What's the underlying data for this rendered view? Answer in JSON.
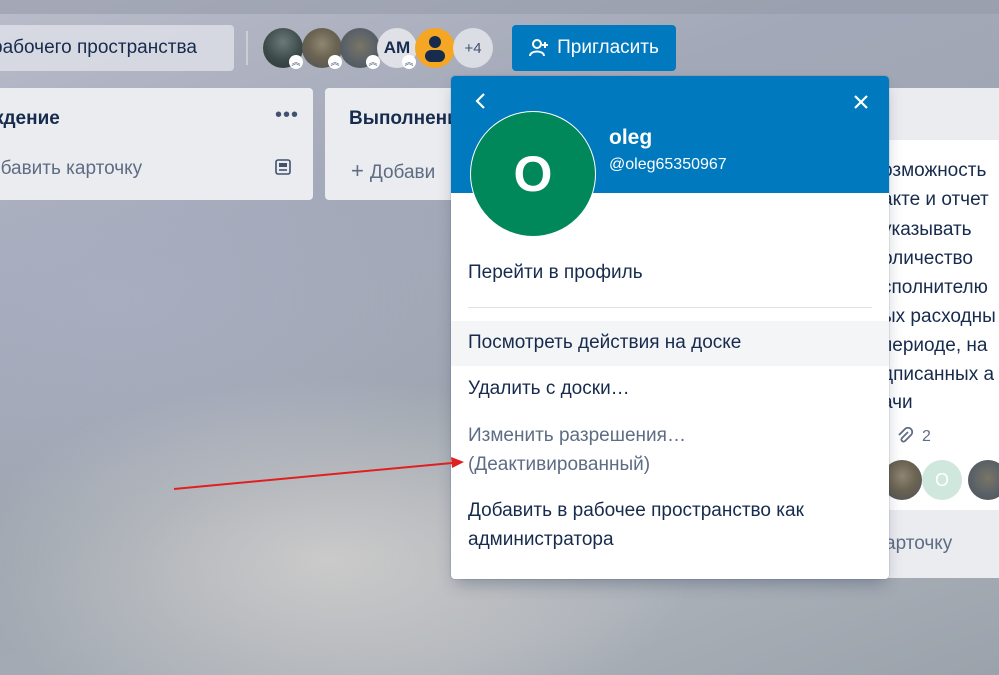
{
  "header": {
    "workspace_button": "рабочего пространства",
    "members_more": "+4",
    "member_am_initials": "AM",
    "invite_label": "Пригласить"
  },
  "lists": [
    {
      "title": "ждение",
      "add_card": "обавить карточку"
    },
    {
      "title": "Выполнени",
      "add_card": "Добави"
    }
  ],
  "right_card": {
    "lines": [
      "озможность",
      "акте и отчет",
      "указывать",
      "оличество",
      "сполнителю",
      "ых расходны",
      "периоде, на",
      "дписанных а",
      "ачи"
    ],
    "attachments_count": "2",
    "member_initial": "O",
    "add_card": "арточку"
  },
  "popover": {
    "avatar_initial": "O",
    "name": "oleg",
    "username": "@oleg65350967",
    "go_to_profile": "Перейти в профиль",
    "view_activity": "Посмотреть действия на доске",
    "remove_from_board": "Удалить с доски…",
    "change_permissions": "Изменить разрешения…",
    "deactivated": "(Деактивированный)",
    "add_admin_line1": "Добавить в рабочее пространство как",
    "add_admin_line2": "администратора"
  },
  "colors": {
    "accent": "#0079bf",
    "avatar_green": "#00875a",
    "annotation_arrow": "#e02020"
  }
}
